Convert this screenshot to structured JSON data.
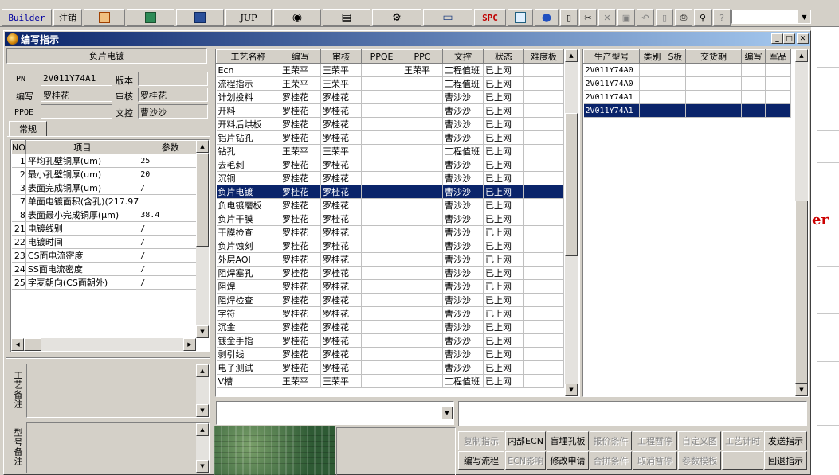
{
  "toolbar": {
    "builder_label": "Builder",
    "logout_label": "注销",
    "jup_label": "JUP",
    "spc_label": "SPC",
    "icons": [
      "office-icon",
      "excel-icon",
      "word-icon",
      "eye-icon",
      "database-icon",
      "network-icon",
      "computer-icon",
      "calendar-icon",
      "internet-icon",
      "new-file-icon",
      "cut-icon",
      "delete-icon",
      "save-icon",
      "undo-icon",
      "preview-icon",
      "print-icon",
      "find-icon",
      "help-icon"
    ]
  },
  "window": {
    "title": "编写指示"
  },
  "left": {
    "process_name": "负片电镀",
    "pn_label": "PN",
    "pn_value": "2V011Y74A1",
    "version_label": "版本",
    "version_value": "",
    "author_label": "编写",
    "author_value": "罗桂花",
    "reviewer_label": "审核",
    "reviewer_value": "罗桂花",
    "ppqe_label": "PPQE",
    "ppqe_value": "",
    "doc_control_label": "文控",
    "doc_control_value": "曹沙沙",
    "tab_label": "常规",
    "param_headers": [
      "NO",
      "项目",
      "参数"
    ],
    "params": [
      {
        "no": "1",
        "item": "平均孔壁铜厚(um)",
        "value": "25"
      },
      {
        "no": "2",
        "item": "最小孔壁铜厚(um)",
        "value": "20"
      },
      {
        "no": "3",
        "item": "表面完成铜厚(um)",
        "value": "/"
      },
      {
        "no": "7",
        "item": "单面电镀面积(含孔)(217.97",
        "value": ""
      },
      {
        "no": "8",
        "item": "表面最小完成铜厚(μm)",
        "value": "38.4"
      },
      {
        "no": "21",
        "item": "电镀线别",
        "value": "/"
      },
      {
        "no": "22",
        "item": "电镀时间",
        "value": "/"
      },
      {
        "no": "23",
        "item": "CS面电流密度",
        "value": "/"
      },
      {
        "no": "24",
        "item": "SS面电流密度",
        "value": "/"
      },
      {
        "no": "25",
        "item": "字麦朝向(CS面朝外)",
        "value": "/"
      }
    ],
    "memo1_label": "工艺备注",
    "memo2_label": "型号备注"
  },
  "process_grid": {
    "headers": [
      "工艺名称",
      "编写",
      "审核",
      "PPQE",
      "PPC",
      "文控",
      "状态",
      "难度板"
    ],
    "selected_index": 13,
    "rows": [
      [
        "Ecn",
        "王荣平",
        "王荣平",
        "",
        "王荣平",
        "工程值班",
        "已上网",
        ""
      ],
      [
        "流程指示",
        "王荣平",
        "王荣平",
        "",
        "",
        "工程值班",
        "已上网",
        ""
      ],
      [
        "计划投料",
        "罗桂花",
        "罗桂花",
        "",
        "",
        "曹沙沙",
        "已上网",
        ""
      ],
      [
        "开料",
        "罗桂花",
        "罗桂花",
        "",
        "",
        "曹沙沙",
        "已上网",
        ""
      ],
      [
        "开料后烘板",
        "罗桂花",
        "罗桂花",
        "",
        "",
        "曹沙沙",
        "已上网",
        ""
      ],
      [
        "铝片钻孔",
        "罗桂花",
        "罗桂花",
        "",
        "",
        "曹沙沙",
        "已上网",
        ""
      ],
      [
        "钻孔",
        "王荣平",
        "王荣平",
        "",
        "",
        "工程值班",
        "已上网",
        ""
      ],
      [
        "去毛刺",
        "罗桂花",
        "罗桂花",
        "",
        "",
        "曹沙沙",
        "已上网",
        ""
      ],
      [
        "沉铜",
        "罗桂花",
        "罗桂花",
        "",
        "",
        "曹沙沙",
        "已上网",
        ""
      ],
      [
        "负片电镀",
        "罗桂花",
        "罗桂花",
        "",
        "",
        "曹沙沙",
        "已上网",
        ""
      ],
      [
        "负电镀磨板",
        "罗桂花",
        "罗桂花",
        "",
        "",
        "曹沙沙",
        "已上网",
        ""
      ],
      [
        "负片干膜",
        "罗桂花",
        "罗桂花",
        "",
        "",
        "曹沙沙",
        "已上网",
        ""
      ],
      [
        "干膜检查",
        "罗桂花",
        "罗桂花",
        "",
        "",
        "曹沙沙",
        "已上网",
        ""
      ],
      [
        "负片蚀刻",
        "罗桂花",
        "罗桂花",
        "",
        "",
        "曹沙沙",
        "已上网",
        ""
      ],
      [
        "外层AOI",
        "罗桂花",
        "罗桂花",
        "",
        "",
        "曹沙沙",
        "已上网",
        ""
      ],
      [
        "阻焊塞孔",
        "罗桂花",
        "罗桂花",
        "",
        "",
        "曹沙沙",
        "已上网",
        ""
      ],
      [
        "阻焊",
        "罗桂花",
        "罗桂花",
        "",
        "",
        "曹沙沙",
        "已上网",
        ""
      ],
      [
        "阻焊检查",
        "罗桂花",
        "罗桂花",
        "",
        "",
        "曹沙沙",
        "已上网",
        ""
      ],
      [
        "字符",
        "罗桂花",
        "罗桂花",
        "",
        "",
        "曹沙沙",
        "已上网",
        ""
      ],
      [
        "沉金",
        "罗桂花",
        "罗桂花",
        "",
        "",
        "曹沙沙",
        "已上网",
        ""
      ],
      [
        "镀金手指",
        "罗桂花",
        "罗桂花",
        "",
        "",
        "曹沙沙",
        "已上网",
        ""
      ],
      [
        "剥引线",
        "罗桂花",
        "罗桂花",
        "",
        "",
        "曹沙沙",
        "已上网",
        ""
      ],
      [
        "电子测试",
        "罗桂花",
        "罗桂花",
        "",
        "",
        "曹沙沙",
        "已上网",
        ""
      ],
      [
        "V槽",
        "王荣平",
        "王荣平",
        "",
        "",
        "工程值班",
        "已上网",
        ""
      ]
    ]
  },
  "model_grid": {
    "headers": [
      "生产型号",
      "类别",
      "S板",
      "交货期",
      "编写",
      "军品"
    ],
    "rows": [
      [
        "2V011Y74A0",
        "",
        "",
        "",
        "",
        ""
      ],
      [
        "2V011Y74A0",
        "",
        "",
        "",
        "",
        ""
      ],
      [
        "2V011Y74A1",
        "",
        "",
        "",
        "",
        ""
      ],
      [
        "2V011Y74A1",
        "",
        "",
        "",
        "",
        ""
      ]
    ],
    "selected_index": 3
  },
  "actions": {
    "row1": [
      {
        "label": "复制指示",
        "enabled": false
      },
      {
        "label": "内部ECN",
        "enabled": true
      },
      {
        "label": "盲埋孔板",
        "enabled": true
      },
      {
        "label": "报价条件",
        "enabled": false
      },
      {
        "label": "工程暂停",
        "enabled": false
      },
      {
        "label": "自定义图",
        "enabled": false
      },
      {
        "label": "工艺计时",
        "enabled": false
      },
      {
        "label": "发送指示",
        "enabled": true
      }
    ],
    "row2": [
      {
        "label": "编写流程",
        "enabled": true
      },
      {
        "label": "ECN影响",
        "enabled": false
      },
      {
        "label": "修改申请",
        "enabled": true
      },
      {
        "label": "合拼条件",
        "enabled": false
      },
      {
        "label": "取消暂停",
        "enabled": false
      },
      {
        "label": "参数模板",
        "enabled": false
      },
      {
        "label": "",
        "enabled": false
      },
      {
        "label": "回退指示",
        "enabled": true
      }
    ]
  },
  "background_window": {
    "text": "er"
  }
}
